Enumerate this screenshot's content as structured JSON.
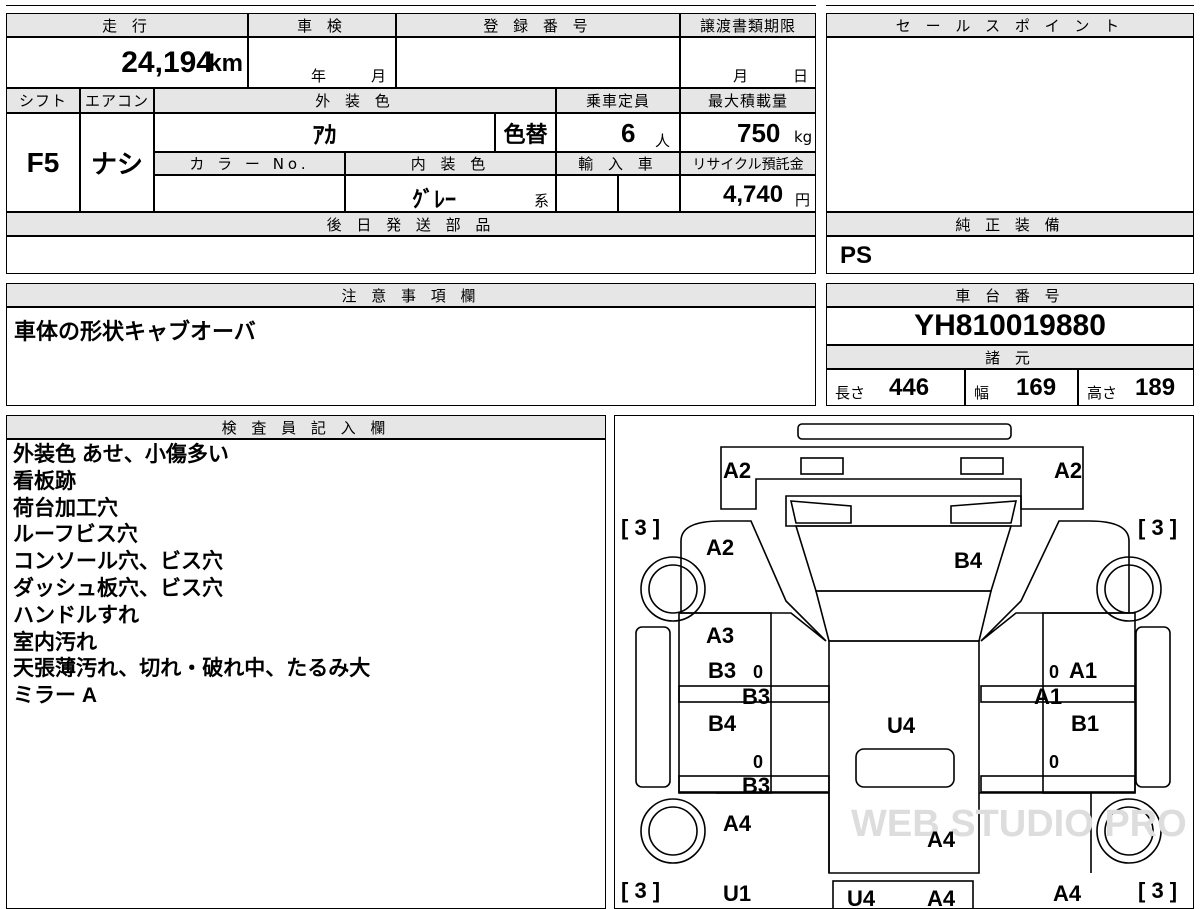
{
  "top": {
    "mileage_label": "走 行",
    "mileage_value": "24,194",
    "mileage_unit": "km",
    "inspection_label": "車 検",
    "inspection_year": "年",
    "inspection_month": "月",
    "registration_label": "登 録 番 号",
    "registration_value": "",
    "transfer_label": "譲渡書類期限",
    "transfer_month": "月",
    "transfer_day": "日"
  },
  "specs": {
    "shift_label": "シフト",
    "shift_value": "F5",
    "ac_label": "エアコン",
    "ac_value": "ナシ",
    "exterior_color_label": "外 装 色",
    "exterior_color_value": "ｱｶ",
    "color_change": "色替",
    "capacity_label": "乗車定員",
    "capacity_value": "6",
    "capacity_unit": "人",
    "max_load_label": "最大積載量",
    "max_load_value": "750",
    "max_load_unit": "kg",
    "color_no_label": "カ ラ ー No.",
    "color_no_value": "",
    "interior_color_label": "内 装 色",
    "interior_color_value": "ｸﾞﾚｰ",
    "interior_suffix": "系",
    "import_label": "輸 入 車",
    "recycle_label": "リサイクル預託金",
    "recycle_value": "4,740",
    "recycle_unit": "円"
  },
  "later_parts": {
    "label": "後 日 発 送 部 品",
    "value": ""
  },
  "sales_point": {
    "label": "セ ー ル ス ポ イ ン ト",
    "value": ""
  },
  "genuine_equipment": {
    "label": "純 正 装 備",
    "value": "PS"
  },
  "notes": {
    "label": "注 意 事 項 欄",
    "value": "車体の形状キャブオーバ"
  },
  "chassis": {
    "label": "車 台 番 号",
    "value": "YH810019880"
  },
  "dimensions": {
    "label": "諸 元",
    "length_label": "長さ",
    "length_value": "446",
    "width_label": "幅",
    "width_value": "169",
    "height_label": "高さ",
    "height_value": "189"
  },
  "inspector": {
    "label": "検 査 員 記 入 欄",
    "lines": [
      "外装色 あせ、小傷多い",
      "看板跡",
      "荷台加工穴",
      "ルーフビス穴",
      "コンソール穴、ビス穴",
      "ダッシュ板穴、ビス穴",
      "ハンドルすれ",
      "室内汚れ",
      "天張薄汚れ、切れ・破れ中、たるみ大",
      "ミラー A"
    ]
  },
  "diagram": {
    "watermark": "WEB STUDIO PRO",
    "marks": {
      "front_left": "A2",
      "front_right": "A2",
      "tire_fl": "[ 3 ]",
      "tire_fr": "[ 3 ]",
      "tire_rl": "[ 3 ]",
      "tire_rr": "[ 3 ]",
      "fender_left": "A2",
      "windshield": "B4",
      "left_a3": "A3",
      "left_b3": "B3",
      "left_mid_b3": "B3",
      "left_b4": "B4",
      "left_low_b3": "B3",
      "right_a1_top": "A1",
      "right_a1_mid": "A1",
      "right_b1": "B1",
      "center_u4": "U4",
      "left_a4": "A4",
      "rear_center_a4": "A4",
      "bottom_left_u1": "U1",
      "bottom_center_u4": "U4",
      "bottom_center_a4": "A4",
      "bottom_right_a4": "A4",
      "zero": "0"
    }
  }
}
